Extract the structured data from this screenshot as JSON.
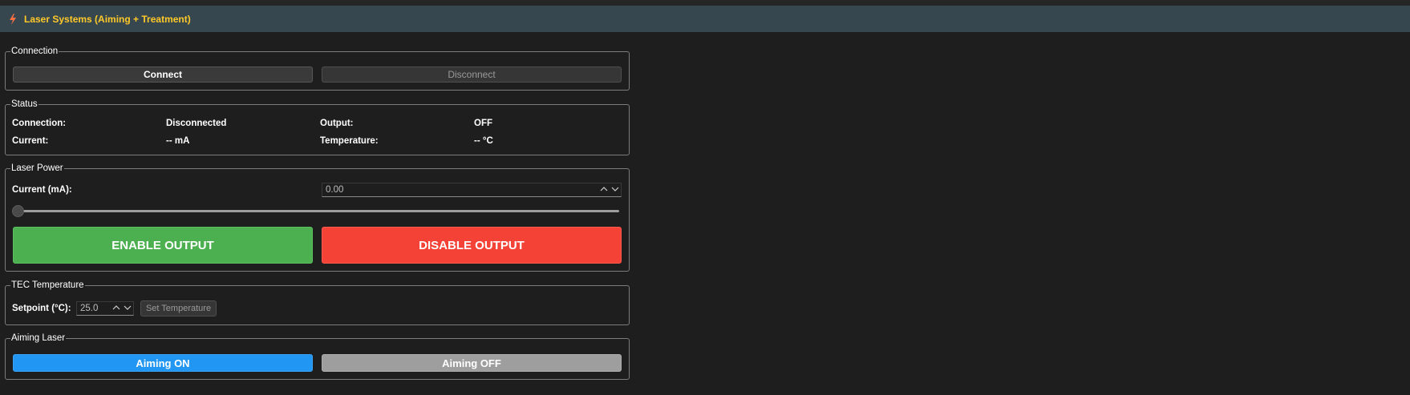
{
  "header": {
    "title": "Laser Systems (Aiming + Treatment)",
    "icon": "lightning-icon"
  },
  "connection": {
    "legend": "Connection",
    "connect_label": "Connect",
    "disconnect_label": "Disconnect"
  },
  "status": {
    "legend": "Status",
    "connection_label": "Connection:",
    "connection_value": "Disconnected",
    "output_label": "Output:",
    "output_value": "OFF",
    "current_label": "Current:",
    "current_value": "-- mA",
    "temperature_label": "Temperature:",
    "temperature_value": "-- °C"
  },
  "laser_power": {
    "legend": "Laser Power",
    "current_label": "Current (mA):",
    "current_value": "0.00",
    "slider_level": 0,
    "enable_label": "ENABLE OUTPUT",
    "disable_label": "DISABLE OUTPUT",
    "enable_color": "#4caf50",
    "disable_color": "#f44336"
  },
  "tec": {
    "legend": "TEC Temperature",
    "setpoint_label": "Setpoint (°C):",
    "setpoint_value": "25.0",
    "set_button_label": "Set Temperature"
  },
  "aiming": {
    "legend": "Aiming Laser",
    "on_label": "Aiming ON",
    "off_label": "Aiming OFF",
    "on_color": "#2196f3",
    "off_color": "#9e9e9e"
  }
}
